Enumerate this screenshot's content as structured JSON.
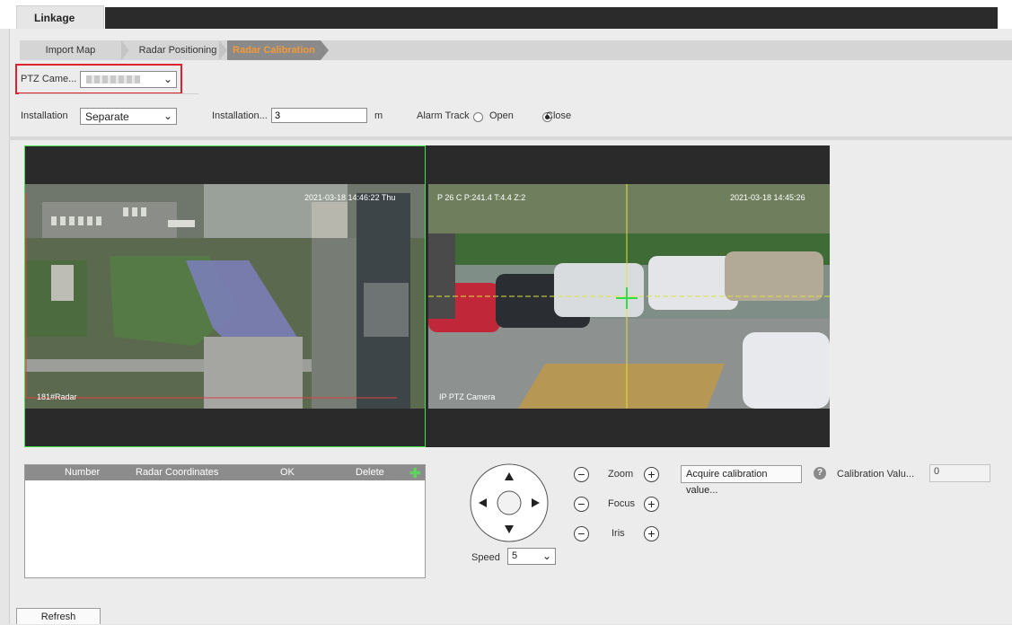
{
  "app": {
    "tab_title": "Linkage"
  },
  "steps": [
    "Import Map",
    "Radar Positioning",
    "Radar Calibration"
  ],
  "active_step": "Radar Calibration",
  "ptz_camera": {
    "label": "PTZ Came...",
    "value": ""
  },
  "installation": {
    "label": "Installation",
    "mode": "Separate",
    "distance_label": "Installation...",
    "distance_value": "3",
    "unit": "m"
  },
  "alarm_track": {
    "label": "Alarm Track",
    "open_label": "Open",
    "close_label": "Close",
    "selected": "Close"
  },
  "video": {
    "left": {
      "timestamp": "2021-03-18 14:46:22 Thu",
      "name": "181#Radar"
    },
    "right": {
      "ptz_info": "P 26 C P:241.4 T:4.4 Z:2",
      "timestamp": "2021-03-18 14:45:26",
      "name": "IP PTZ Camera"
    }
  },
  "table": {
    "headers": [
      "Number",
      "Radar Coordinates",
      "OK",
      "Delete"
    ],
    "rows": []
  },
  "ptz_control": {
    "speed_label": "Speed",
    "speed_value": "5",
    "zoom_label": "Zoom",
    "focus_label": "Focus",
    "iris_label": "Iris"
  },
  "calibration": {
    "acquire_button": "Acquire calibration value...",
    "value_label": "Calibration Valu...",
    "value": "0"
  },
  "refresh_button": "Refresh"
}
